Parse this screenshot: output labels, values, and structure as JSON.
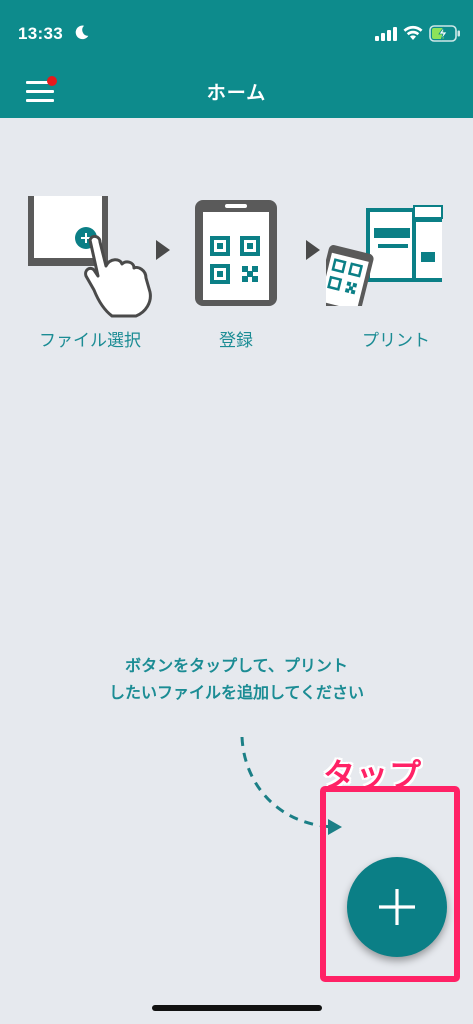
{
  "status_bar": {
    "time": "13:33",
    "icons": [
      "moon-icon",
      "cellular-signal-icon",
      "wifi-icon",
      "battery-charging-icon"
    ]
  },
  "header": {
    "title": "ホーム",
    "menu_icon": "hamburger-menu-icon",
    "has_notification": true
  },
  "steps": [
    {
      "label": "ファイル選択",
      "icon": "tablet-tap-add-icon"
    },
    {
      "label": "登録",
      "icon": "phone-qr-icon"
    },
    {
      "label": "プリント",
      "icon": "printer-qr-icon"
    }
  ],
  "hint": {
    "line1": "ボタンをタップして、プリント",
    "line2": "したいファイルを追加してください"
  },
  "callout": {
    "text": "タップ"
  },
  "fab": {
    "icon": "plus-icon"
  },
  "colors": {
    "primary": "#0d8b8c",
    "background": "#e6e9ee",
    "accent_text": "#1b8c94",
    "highlight": "#ff2266",
    "notification": "#e41a1c"
  }
}
